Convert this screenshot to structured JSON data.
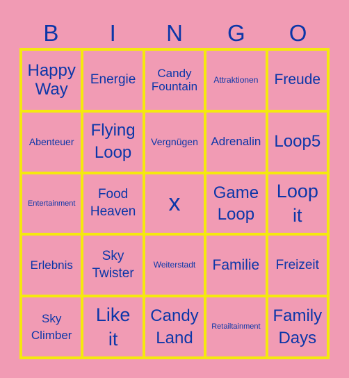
{
  "header": {
    "letters": [
      "B",
      "I",
      "N",
      "G",
      "O"
    ]
  },
  "colors": {
    "background": "#f19bb4",
    "grid_lines": "#f5e90e",
    "text": "#0b36a8"
  },
  "cells": [
    [
      "Happy Way",
      "Energie",
      "Candy Fountain",
      "Attraktionen",
      "Freude"
    ],
    [
      "Abenteuer",
      "Flying Loop",
      "Vergnügen",
      "Adrenalin",
      "Loop5"
    ],
    [
      "Entertainment",
      "Food Heaven",
      "x",
      "Game Loop",
      "Loop it"
    ],
    [
      "Erlebnis",
      "Sky Twister",
      "Weiterstadt",
      "Familie",
      "Freizeit"
    ],
    [
      "Sky Climber",
      "Like it",
      "Candy Land",
      "Retailtainment",
      "Family Days"
    ]
  ]
}
